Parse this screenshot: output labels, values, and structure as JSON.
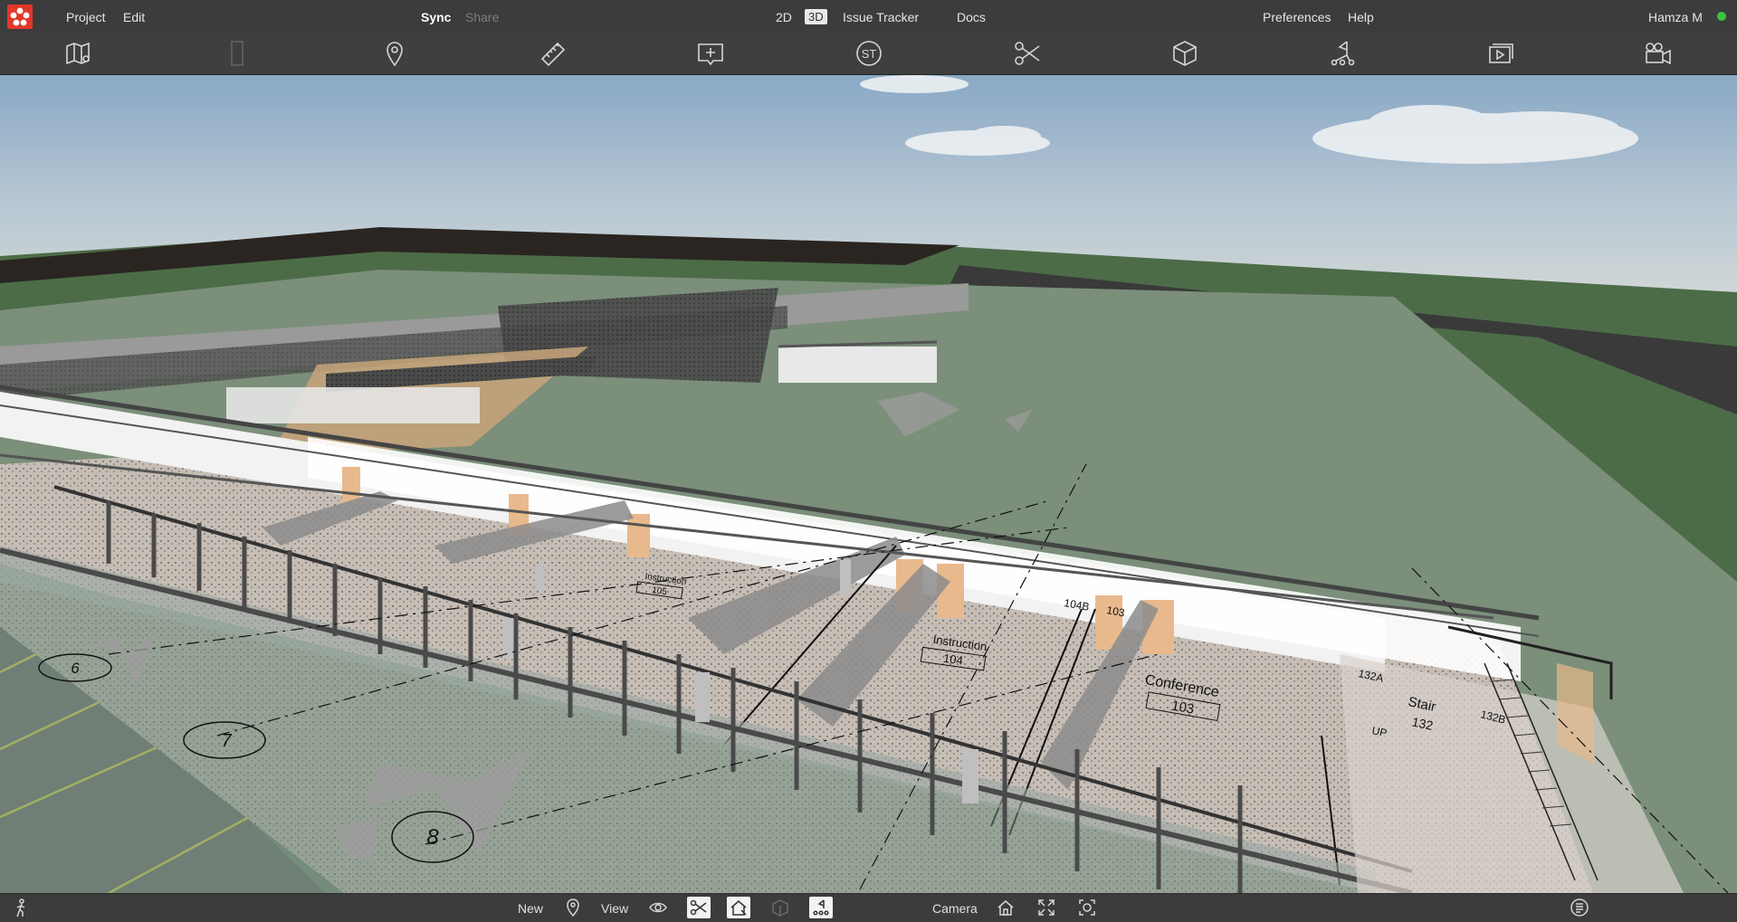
{
  "menubar": {
    "project": "Project",
    "edit": "Edit",
    "sync": "Sync",
    "share": "Share",
    "mode_2d": "2D",
    "mode_3d": "3D",
    "issue_tracker": "Issue Tracker",
    "docs": "Docs",
    "preferences": "Preferences",
    "help": "Help",
    "user": "Hamza M"
  },
  "toolbar": {
    "icons": [
      "map-pin-icon",
      "panel-icon",
      "location-pin-icon",
      "ruler-icon",
      "comment-add-icon",
      "st-icon",
      "scissors-icon",
      "cube-icon",
      "path-icon",
      "slides-icon",
      "video-camera-icon"
    ],
    "st_label": "ST"
  },
  "scene": {
    "grid_labels": [
      "6",
      "7",
      "8"
    ],
    "rooms": [
      {
        "name": "Instruction",
        "number": "104"
      },
      {
        "name": "Conference",
        "number": "103"
      },
      {
        "name": "Stair",
        "number": "132"
      },
      {
        "name": "Instruction",
        "number": "105"
      }
    ],
    "tags": [
      "103",
      "132A",
      "132B",
      "104B"
    ],
    "up_label": "UP"
  },
  "bottombar": {
    "new": "New",
    "view": "View",
    "camera": "Camera"
  },
  "colors": {
    "sky_top": "#8cacc6",
    "ground": "#7b8f7a",
    "accent": "#e2372a",
    "status": "#3cc43c"
  }
}
